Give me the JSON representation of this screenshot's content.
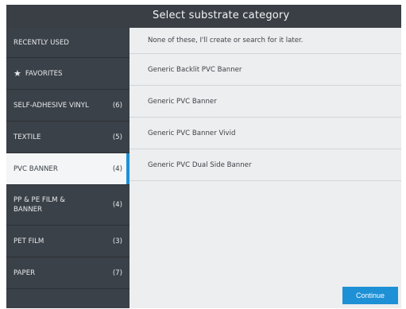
{
  "title": "Select substrate category",
  "sidebar": {
    "items": [
      {
        "label": "RECENTLY USED",
        "count": ""
      },
      {
        "label": "FAVORITES",
        "count": "",
        "icon": "star-icon"
      },
      {
        "label": "SELF-ADHESIVE VINYL",
        "count": "(6)"
      },
      {
        "label": "TEXTILE",
        "count": "(5)"
      },
      {
        "label": "PVC BANNER",
        "count": "(4)",
        "selected": true
      },
      {
        "label": "PP & PE FILM &\nBANNER",
        "count": "(4)"
      },
      {
        "label": "PET FILM",
        "count": "(3)"
      },
      {
        "label": "PAPER",
        "count": "(7)"
      }
    ]
  },
  "list": {
    "items": [
      "None of these, I'll create or search for it later.",
      "Generic Backlit PVC Banner",
      "Generic PVC Banner",
      "Generic PVC Banner Vivid",
      "Generic PVC Dual Side Banner"
    ]
  },
  "actions": {
    "continue_label": "Continue"
  },
  "colors": {
    "accent": "#1e90d5",
    "sidebar_bg": "#3b4148",
    "title_bg": "#3a3f45",
    "content_bg": "#eceeef"
  }
}
